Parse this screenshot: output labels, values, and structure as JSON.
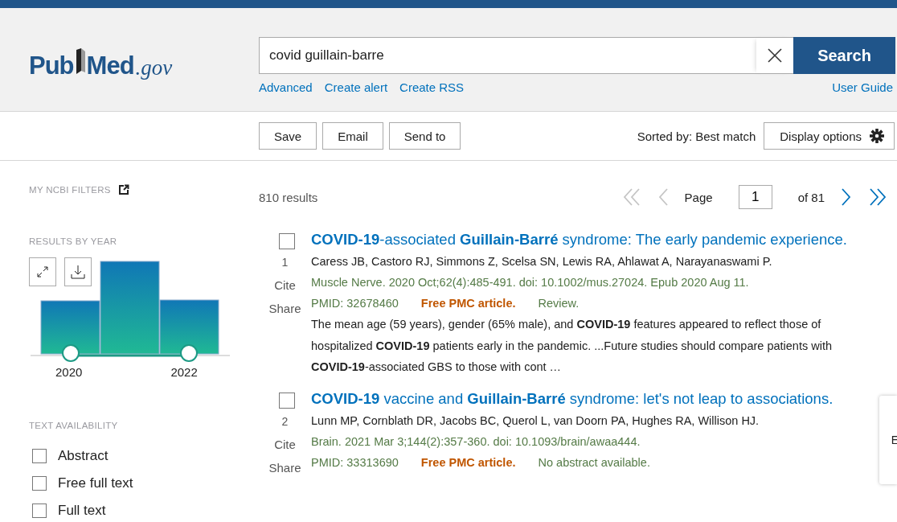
{
  "header": {
    "logo": {
      "parts": [
        "Pub",
        "Med"
      ],
      "suffix": ".gov"
    },
    "search": {
      "value": "covid guillain-barre",
      "button": "Search"
    },
    "links": [
      "Advanced",
      "Create alert",
      "Create RSS"
    ],
    "user_guide": "User Guide"
  },
  "toolbar": {
    "buttons": [
      "Save",
      "Email",
      "Send to"
    ],
    "sort": "Sorted by: Best match",
    "display_options": "Display options"
  },
  "sidebar": {
    "my_filters": "MY NCBI FILTERS",
    "by_year": {
      "title": "RESULTS BY YEAR",
      "years": [
        "2020",
        "2022"
      ]
    },
    "text_availability": {
      "title": "TEXT AVAILABILITY",
      "options": [
        {
          "label": "Abstract",
          "checked": false
        },
        {
          "label": "Free full text",
          "checked": false
        },
        {
          "label": "Full text",
          "checked": false
        }
      ]
    }
  },
  "results_bar": {
    "count": "810 results",
    "page_label": "Page",
    "page": "1",
    "of": "of 81",
    "nav": [
      {
        "kind": "first",
        "disabled": true
      },
      {
        "kind": "prev",
        "disabled": true
      },
      {
        "kind": "next",
        "disabled": false
      },
      {
        "kind": "last",
        "disabled": false
      }
    ]
  },
  "results": [
    {
      "checked": false,
      "number": "1",
      "cite": "Cite",
      "share": "Share",
      "title": "**COVID-19**-associated **Guillain-Barré** syndrome: The early pandemic experience.",
      "authors": "Caress JB, Castoro RJ, Simmons Z, Scelsa SN, Lewis RA, Ahlawat A, Narayanaswami P.",
      "citation": "Muscle Nerve. 2020 Oct;62(4):485-491. doi: 10.1002/mus.27024. Epub 2020 Aug 11.",
      "pmid": "PMID: 32678460",
      "free": "Free PMC article.",
      "note": "Review.",
      "snippet": "The mean age (59 years), gender (65% male), and **COVID-19** features appeared to reflect those of hospitalized **COVID-19** patients early in the pandemic. ...Future studies should compare patients with **COVID-19**-associated GBS to those with cont …"
    },
    {
      "checked": false,
      "number": "2",
      "cite": "Cite",
      "share": "Share",
      "title": "**COVID-19** vaccine and **Guillain-Barré** syndrome: let's not leap to associations.",
      "authors": "Lunn MP, Cornblath DR, Jacobs BC, Querol L, van Doorn PA, Hughes RA, Willison HJ.",
      "citation": "Brain. 2021 Mar 3;144(2):357-360. doi: 10.1093/brain/awaa444.",
      "pmid": "PMID: 33313690",
      "free": "Free PMC article.",
      "note": "No abstract available."
    }
  ],
  "side_panel": {
    "text": "E"
  }
}
